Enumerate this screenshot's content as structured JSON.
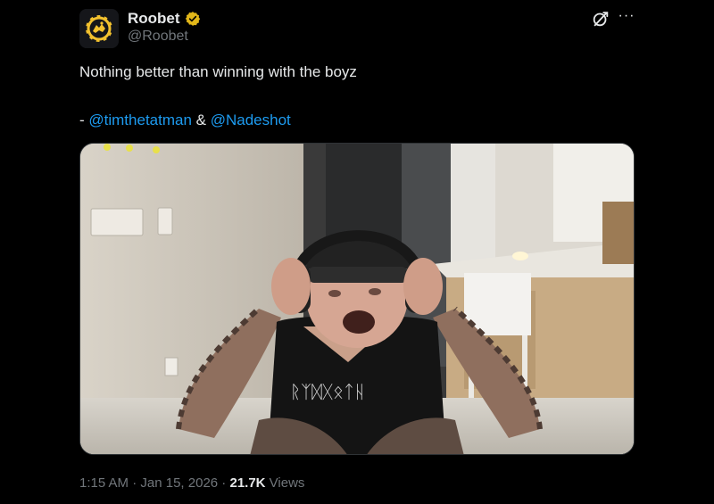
{
  "author": {
    "display_name": "Roobet",
    "handle": "@Roobet",
    "avatar_icon": "roobet-kangaroo-logo",
    "verified_badge_color": "#e2b719"
  },
  "tweet": {
    "text_line1": "Nothing better than winning with the boyz",
    "dash": "- ",
    "mention1": "@timthetatman",
    "amp": " & ",
    "mention2": "@Nadeshot",
    "media_description_icon": "video-still"
  },
  "meta": {
    "time": "1:15 AM",
    "sep1": " · ",
    "date": "Jan 15, 2026",
    "sep2": " · ",
    "views_count": "21.7K",
    "views_label": " Views"
  },
  "icons": {
    "grok": "grok-icon",
    "more": "more-icon"
  },
  "colors": {
    "background": "#000000",
    "text": "#e7e9ea",
    "secondary": "#71767b",
    "link": "#1d9bf0",
    "badge": "#e2b719"
  }
}
